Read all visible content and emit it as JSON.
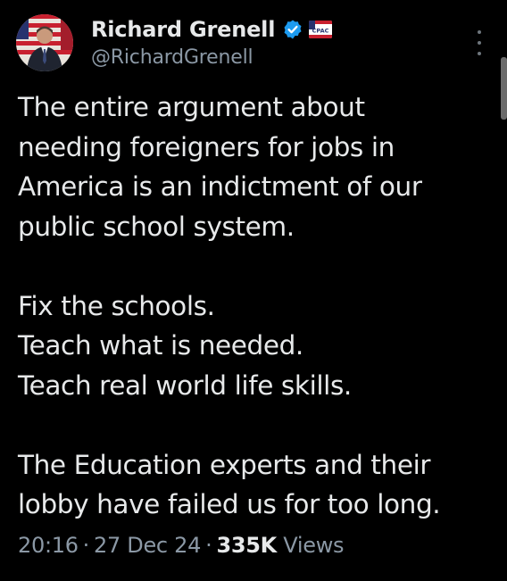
{
  "author": {
    "display_name": "Richard Grenell",
    "handle": "@RichardGrenell",
    "verified_icon": "verified-badge-icon",
    "affiliate_badge": "cpac-badge",
    "affiliate_badge_text": "CPAC"
  },
  "tweet": {
    "paragraphs": [
      [
        "The entire argument about",
        "needing foreigners for jobs in",
        "America is an indictment of our",
        "public school system."
      ],
      [
        "Fix the schools.",
        "Teach what is needed.",
        "Teach real world life skills."
      ],
      [
        "The Education experts and their",
        "lobby have failed us for too long."
      ]
    ]
  },
  "meta": {
    "time": "20:16",
    "date": "27 Dec 24",
    "separator": "·",
    "views_count": "335K",
    "views_label": "Views"
  },
  "colors": {
    "background": "#000000",
    "text_primary": "#e7e9ea",
    "text_secondary": "#8b98a5",
    "verified_blue": "#1d9bf0"
  }
}
